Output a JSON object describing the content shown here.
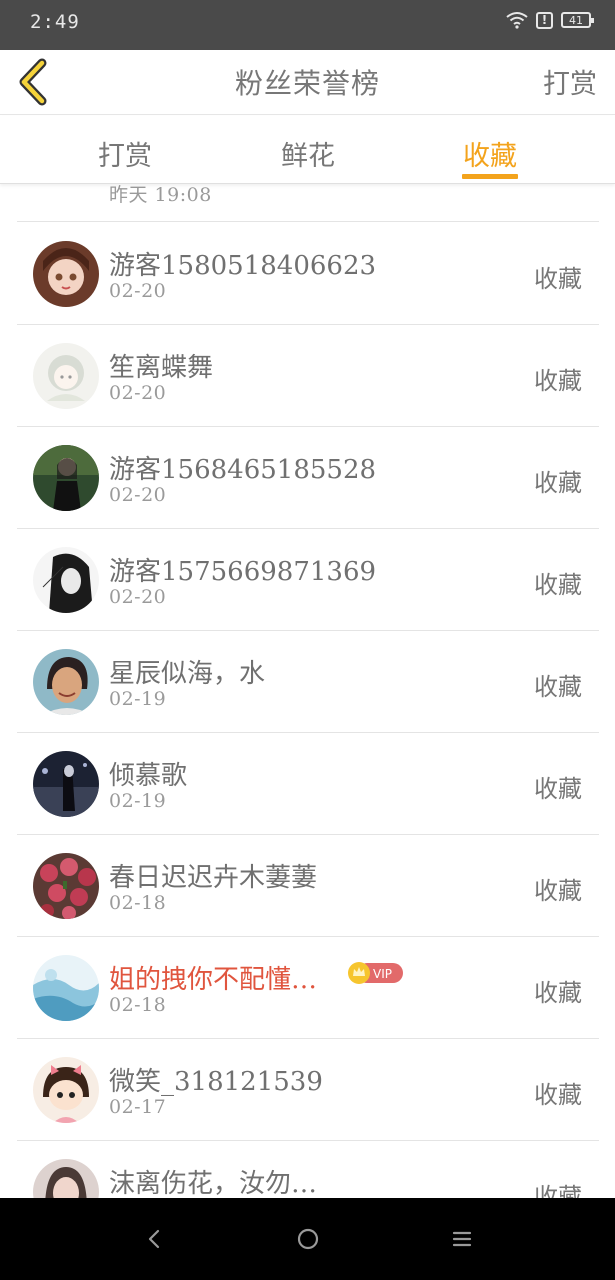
{
  "status_bar": {
    "time": "2:49",
    "battery": "41",
    "alert": "!"
  },
  "header": {
    "title": "粉丝荣誉榜",
    "right_action": "打赏"
  },
  "tabs": [
    {
      "label": "打赏",
      "active": false
    },
    {
      "label": "鲜花",
      "active": false
    },
    {
      "label": "收藏",
      "active": true
    }
  ],
  "accent_color": "#f3a31c",
  "vip_name_color": "#e0553e",
  "fans": [
    {
      "name": "",
      "date": "昨天 19:08",
      "action": "",
      "avatar": "pink-avatar"
    },
    {
      "name": "游客1580518406623",
      "date": "02-20",
      "action": "收藏",
      "avatar": "doll-avatar"
    },
    {
      "name": "笙离蝶舞",
      "date": "02-20",
      "action": "收藏",
      "avatar": "anime-girl-avatar"
    },
    {
      "name": "游客1568465185528",
      "date": "02-20",
      "action": "收藏",
      "avatar": "woman-black-dress-avatar"
    },
    {
      "name": "游客1575669871369",
      "date": "02-20",
      "action": "收藏",
      "avatar": "monochrome-girl-avatar"
    },
    {
      "name": "星辰似海，水",
      "date": "02-19",
      "action": "收藏",
      "avatar": "smiling-woman-avatar"
    },
    {
      "name": "倾慕歌",
      "date": "02-19",
      "action": "收藏",
      "avatar": "night-street-avatar"
    },
    {
      "name": "春日迟迟卉木萋萋",
      "date": "02-18",
      "action": "收藏",
      "avatar": "roses-avatar"
    },
    {
      "name": "姐的拽你不配懂…",
      "date": "02-18",
      "action": "收藏",
      "avatar": "blue-watercolor-avatar",
      "vip": true,
      "vip_label": "VIP"
    },
    {
      "name": "微笑_318121539",
      "date": "02-17",
      "action": "收藏",
      "avatar": "cartoon-girl-avatar"
    },
    {
      "name": "沫离伤花，汝勿…",
      "date": "",
      "action": "收藏",
      "avatar": "portrait-avatar"
    }
  ]
}
